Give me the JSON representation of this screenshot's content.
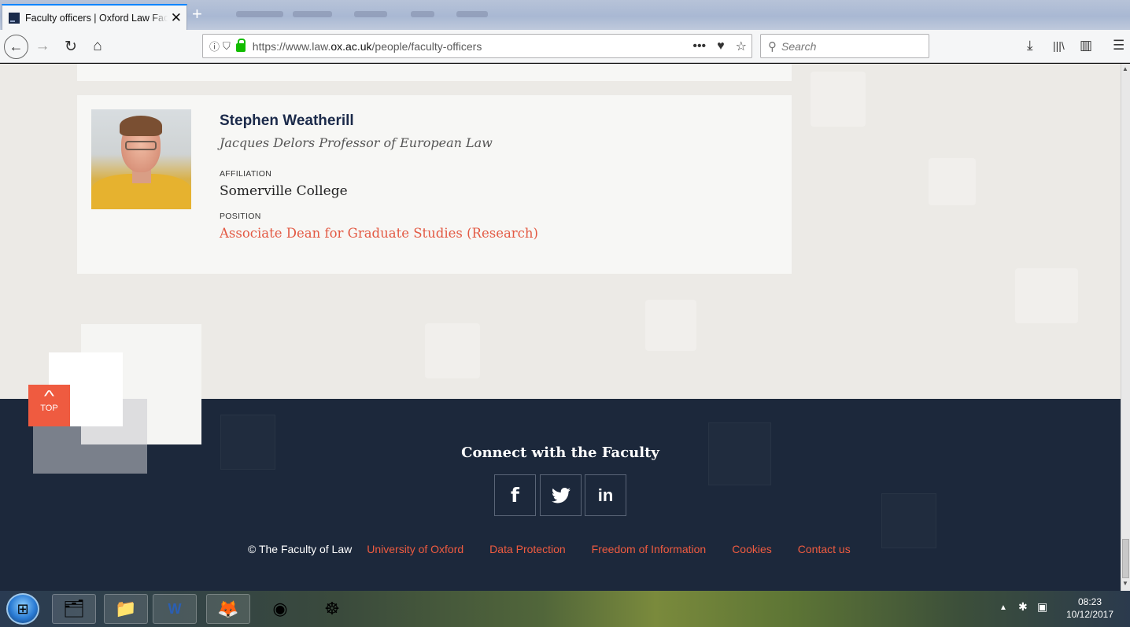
{
  "browser": {
    "tab_title": "Faculty officers | Oxford Law Faculty",
    "tab_close": "✕",
    "new_tab": "+",
    "url_prefix": "https://www.law.",
    "url_domain": "ox.ac.uk",
    "url_path": "/people/faculty-officers",
    "search_placeholder": "Search",
    "more_actions": "•••"
  },
  "person": {
    "name": "Stephen Weatherill",
    "title": "Jacques Delors Professor of European Law",
    "affiliation_label": "AFFILIATION",
    "affiliation": "Somerville College",
    "position_label": "POSITION",
    "position": "Associate Dean for Graduate Studies (Research)"
  },
  "top_button": {
    "label": "TOP"
  },
  "footer": {
    "connect_heading": "Connect with the Faculty",
    "social": {
      "facebook": "f",
      "twitter": "🐦",
      "linkedin": "in"
    },
    "copyright": "© The Faculty of Law",
    "links": [
      "University of Oxford",
      "Data Protection",
      "Freedom of Information",
      "Cookies",
      "Contact us"
    ]
  },
  "taskbar": {
    "time": "08:23",
    "date": "10/12/2017"
  },
  "colors": {
    "accent": "#ef5b40",
    "navy": "#1c283b",
    "name_navy": "#1b2a4a",
    "page_bg": "#eceae6"
  },
  "icons": [
    "back-icon",
    "forward-icon",
    "reload-icon",
    "home-icon",
    "info-icon",
    "tracking-shield-icon",
    "lock-icon",
    "page-actions-icon",
    "pocket-icon",
    "bookmark-star-icon",
    "search-icon",
    "download-icon",
    "library-icon",
    "sidebar-icon",
    "menu-icon",
    "chevron-up-icon",
    "facebook-icon",
    "twitter-icon",
    "linkedin-icon",
    "windows-start-icon"
  ]
}
